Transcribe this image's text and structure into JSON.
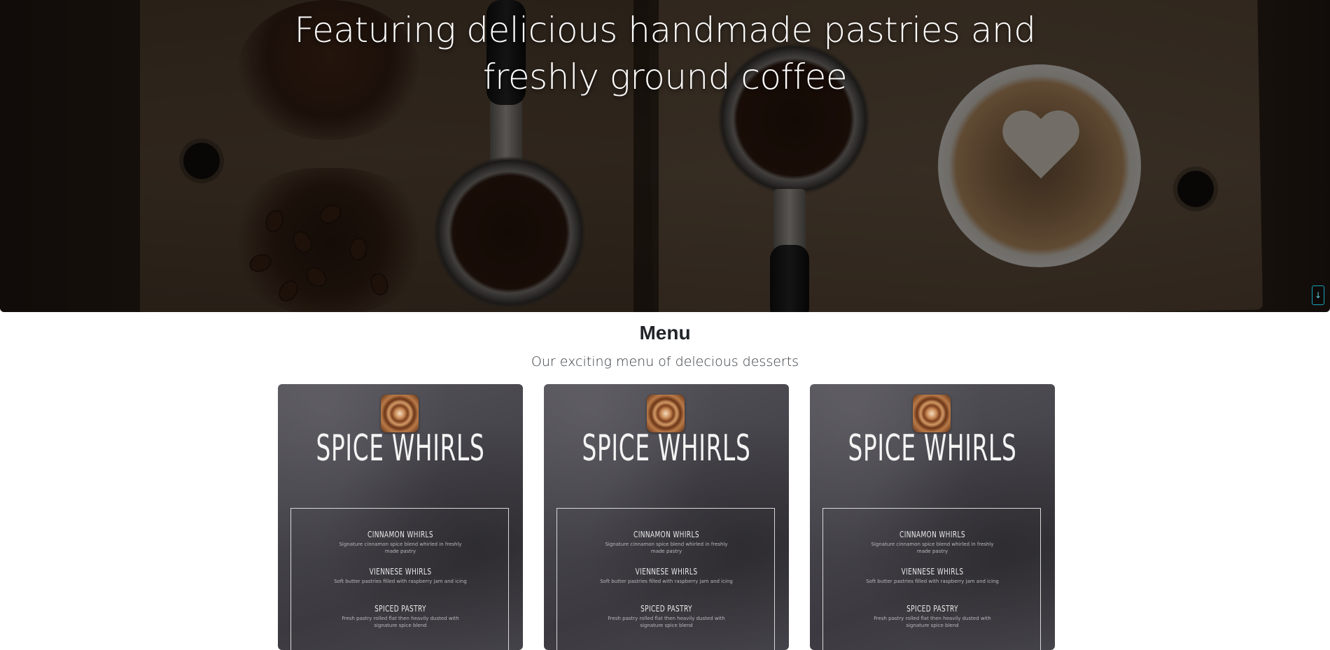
{
  "hero": {
    "title": "Featuring delicious handmade pastries and freshly ground coffee",
    "scroll_button": "↓"
  },
  "menu": {
    "heading": "Menu",
    "subheading": "Our exciting menu of delecious desserts",
    "cards": [
      {
        "title": "SPICE WHIRLS",
        "items": [
          {
            "name": "CINNAMON WHIRLS",
            "desc": "Signature cinnamon spice blend whirled in freshly made pastry"
          },
          {
            "name": "VIENNESE WHIRLS",
            "desc": "Soft butter pastries filled with raspberry jam and icing"
          },
          {
            "name": "SPICED PASTRY",
            "desc": "Fresh pastry rolled flat then heavily dusted with signature spice blend"
          }
        ]
      },
      {
        "title": "SPICE WHIRLS",
        "items": [
          {
            "name": "CINNAMON WHIRLS",
            "desc": "Signature cinnamon spice blend whirled in freshly made pastry"
          },
          {
            "name": "VIENNESE WHIRLS",
            "desc": "Soft butter pastries filled with raspberry jam and icing"
          },
          {
            "name": "SPICED PASTRY",
            "desc": "Fresh pastry rolled flat then heavily dusted with signature spice blend"
          }
        ]
      },
      {
        "title": "SPICE WHIRLS",
        "items": [
          {
            "name": "CINNAMON WHIRLS",
            "desc": "Signature cinnamon spice blend whirled in freshly made pastry"
          },
          {
            "name": "VIENNESE WHIRLS",
            "desc": "Soft butter pastries filled with raspberry jam and icing"
          },
          {
            "name": "SPICED PASTRY",
            "desc": "Fresh pastry rolled flat then heavily dusted with signature spice blend"
          }
        ]
      }
    ]
  }
}
